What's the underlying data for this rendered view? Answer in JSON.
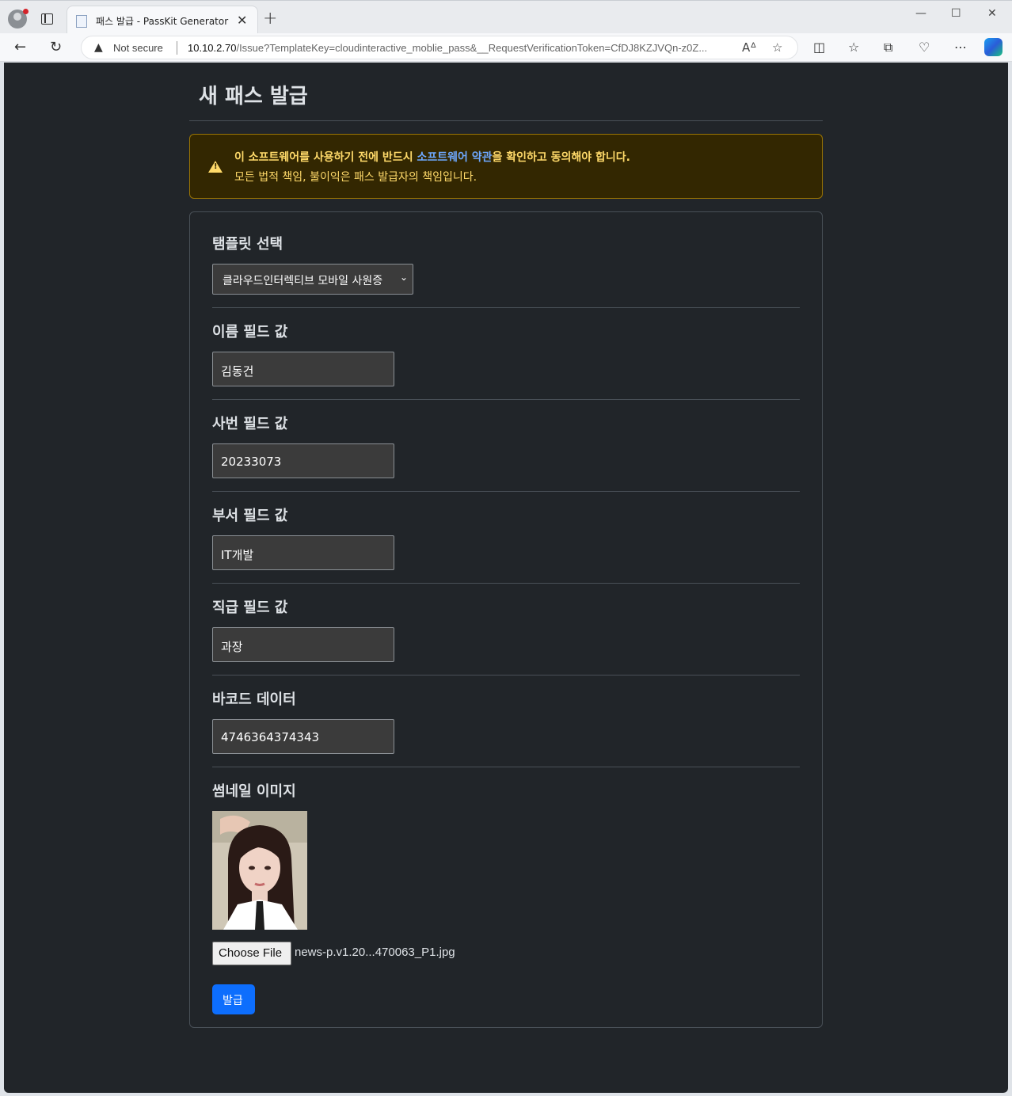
{
  "browser": {
    "tab_title": "패스 발급 - PassKit Generator",
    "tab_close": "✕",
    "new_tab": "+",
    "security_label": "Not secure",
    "url_host": "10.10.2.70",
    "url_path": "/Issue?TemplateKey=cloudinteractive_moblie_pass&__RequestVerificationToken=CfDJ8KZJVQn-z0Z..."
  },
  "page": {
    "title": "새 패스 발급",
    "alert": {
      "line1_prefix": "이 소프트웨어를 사용하기 전에 반드시 ",
      "line1_link": "소프트웨어 약관",
      "line1_suffix": "을 확인하고 동의해야 합니다.",
      "line2": "모든 법적 책임, 불이익은 패스 발급자의 책임입니다."
    },
    "form": {
      "template_label": "탬플릿 선택",
      "template_value": "클라우드인터렉티브 모바일 사원증",
      "name_label": "이름 필드 값",
      "name_value": "김동건",
      "employee_no_label": "사번 필드 값",
      "employee_no_value": "20233073",
      "department_label": "부서 필드 값",
      "department_value": "IT개발",
      "position_label": "직급 필드 값",
      "position_value": "과장",
      "barcode_label": "바코드 데이터",
      "barcode_value": "4746364374343",
      "thumbnail_label": "썸네일 이미지",
      "choose_file_label": "Choose File",
      "file_name": "news-p.v1.20...470063_P1.jpg",
      "submit_label": "발급"
    }
  },
  "colors": {
    "page_bg": "#212529",
    "alert_bg": "#332701",
    "alert_text": "#ffda6a",
    "link": "#6ea8fe",
    "primary": "#0d6efd"
  }
}
